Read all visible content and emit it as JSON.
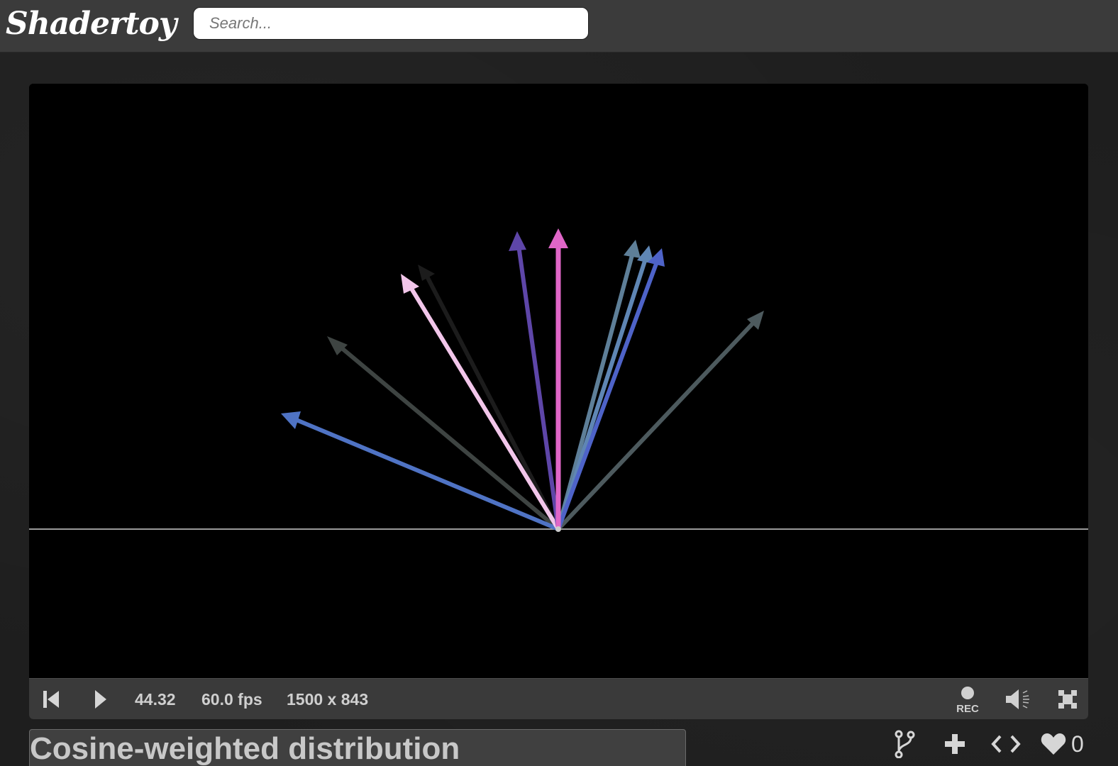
{
  "header": {
    "logo_text": "Shadertoy",
    "search_placeholder": "Search..."
  },
  "player": {
    "time": "44.32",
    "fps": "60.0 fps",
    "resolution": "1500 x 843",
    "rec_label": "REC"
  },
  "shader": {
    "title": "Cosine-weighted distribution",
    "likes": "0"
  },
  "colors": {
    "header_bg": "#3b3b3b",
    "controls_bg": "#3a3a3a",
    "canvas_bg": "#000000"
  },
  "icons": {
    "rewind": "skip-back-icon",
    "play": "play-icon",
    "record": "record-icon",
    "volume": "volume-icon",
    "fullscreen": "fullscreen-icon",
    "fork": "fork-icon",
    "add": "plus-icon",
    "embed": "code-icon",
    "like": "heart-icon"
  }
}
